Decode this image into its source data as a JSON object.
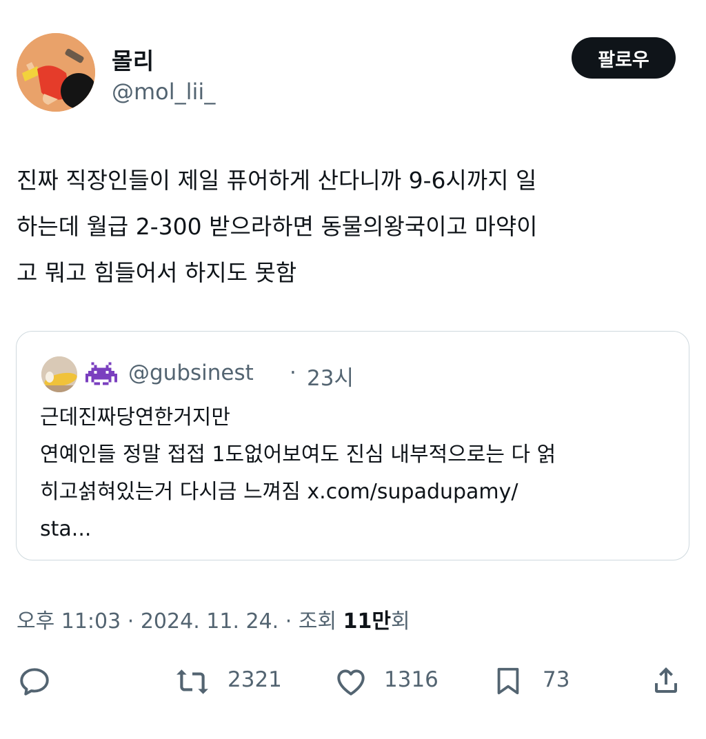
{
  "author": {
    "display_name": "몰리",
    "handle": "@mol_lii_"
  },
  "follow_button": {
    "label": "팔로우"
  },
  "tweet": {
    "lines": [
      "진짜 직장인들이 제일 퓨어하게 산다니까 9-6시까지 일",
      "하는데 월급 2-300 받으라하면 동물의왕국이고 마약이",
      "고 뭐고 힘들어서 하지도 못함"
    ]
  },
  "quote": {
    "handle": "@gubsinest",
    "separator": "·",
    "time": "23시",
    "emoji_icon": "alien-monster-icon",
    "lines": [
      "근데진짜당연한거지만",
      "연예인들 정말 접접 1도없어보여도 진심 내부적으로는 다 얽",
      "히고섥혀있는거 다시금 느껴짐 x.com/supadupamy/",
      "sta..."
    ]
  },
  "meta": {
    "time": "오후 11:03",
    "date": "2024. 11. 24.",
    "views_label": "조회",
    "views_value": "11만",
    "views_suffix": "회",
    "separator": "·"
  },
  "actions": {
    "reply": {
      "icon": "reply-icon",
      "count": ""
    },
    "retweet": {
      "icon": "retweet-icon",
      "count": "2321"
    },
    "like": {
      "icon": "heart-icon",
      "count": "1316"
    },
    "bookmark": {
      "icon": "bookmark-icon",
      "count": "73"
    },
    "share": {
      "icon": "share-icon"
    }
  },
  "colors": {
    "text_primary": "#0f1419",
    "text_secondary": "#536471",
    "border": "#cfd9de",
    "follow_bg": "#0f1419"
  }
}
